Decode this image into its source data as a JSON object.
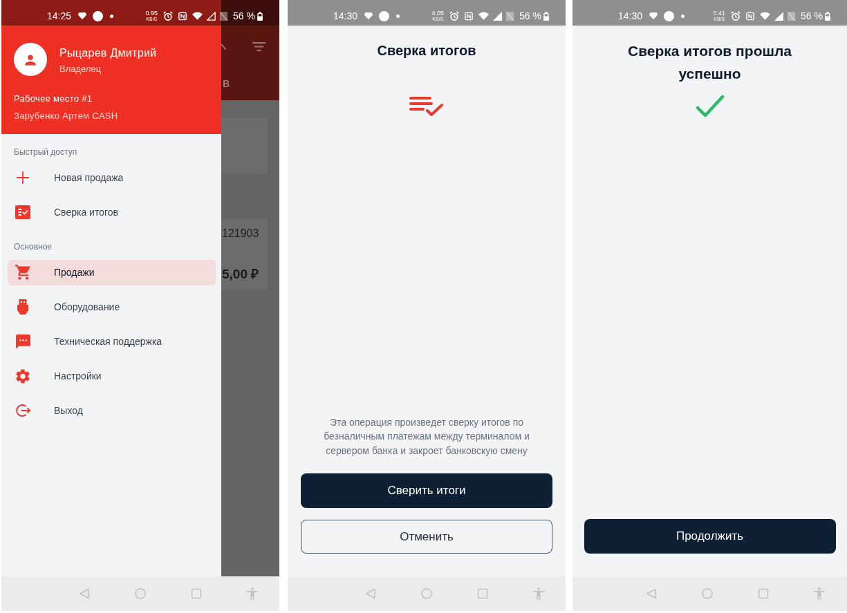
{
  "menu_screen": {
    "status_bar": {
      "time": "14:25",
      "net_speed": "0.95",
      "net_unit": "KB/S",
      "battery": "56 %"
    },
    "background_app": {
      "tab_label": "В",
      "order_number": "121903",
      "amount": "5,00 ₽"
    },
    "drawer": {
      "user_name": "Рыцарев Дмитрий",
      "user_role": "Владелец",
      "workplace": "Рабочее место #1",
      "cashier": "Зарубенко Артем CASH",
      "sections": [
        {
          "title": "Быстрый доступ",
          "items": [
            {
              "label": "Новая продажа",
              "selected": false
            },
            {
              "label": "Сверка итогов",
              "selected": false
            }
          ]
        },
        {
          "title": "Основное",
          "items": [
            {
              "label": "Продажи",
              "selected": true
            },
            {
              "label": "Оборудование",
              "selected": false
            },
            {
              "label": "Техническая поддержка",
              "selected": false
            },
            {
              "label": "Настройки",
              "selected": false
            },
            {
              "label": "Выход",
              "selected": false
            }
          ]
        }
      ]
    }
  },
  "reconciliation_screen": {
    "status_bar": {
      "time": "14:30",
      "net_speed": "4.05",
      "net_unit": "KB/S",
      "battery": "56 %"
    },
    "title": "Сверка итогов",
    "description": "Эта операция произведет сверку итогов по безналичным платежам между терминалом и сервером банка и закроет банковскую смену",
    "buttons": [
      {
        "label": "Сверить итоги",
        "kind": "primary"
      },
      {
        "label": "Отменить",
        "kind": "outline"
      }
    ]
  },
  "success_screen": {
    "status_bar": {
      "time": "14:30",
      "net_speed": "0.41",
      "net_unit": "KB/S",
      "battery": "56 %"
    },
    "title": "Сверка итогов прошла успешно",
    "buttons": [
      {
        "label": "Продолжить",
        "kind": "primary"
      }
    ]
  }
}
